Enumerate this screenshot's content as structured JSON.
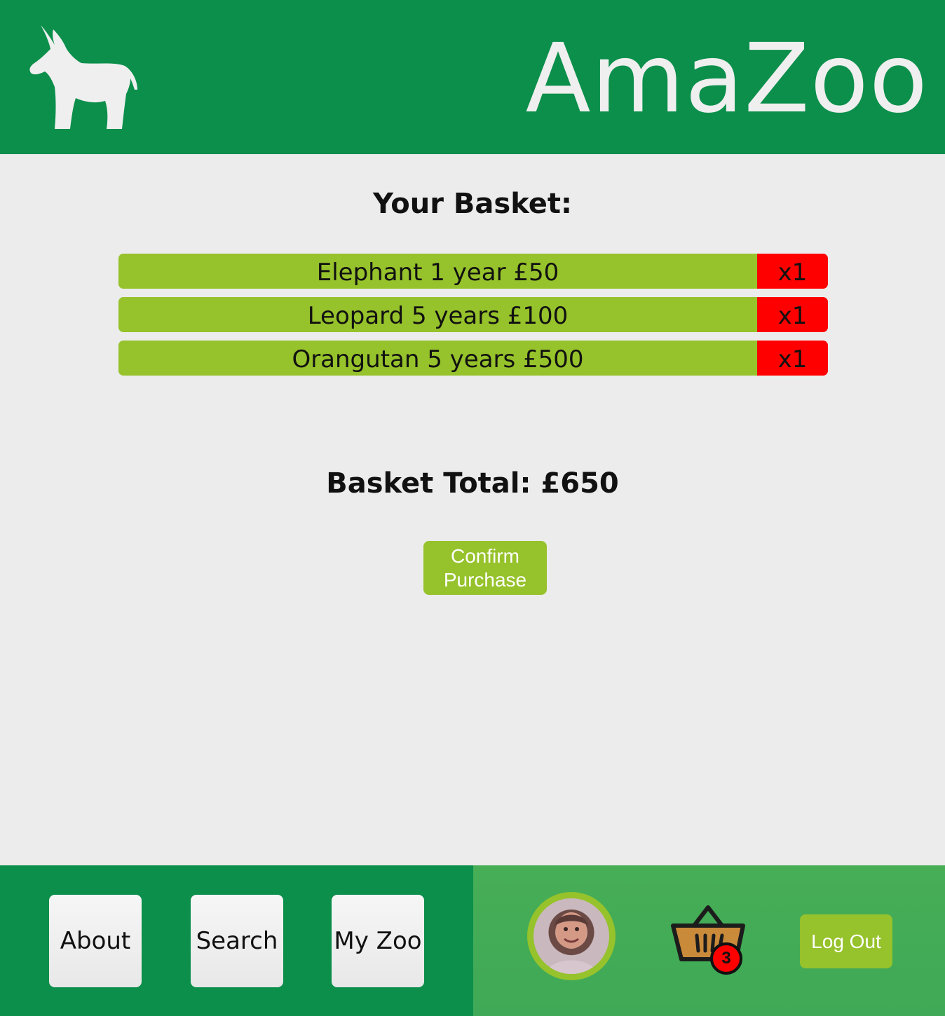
{
  "header": {
    "title": "AmaZoo",
    "logo_icon": "donkey-icon"
  },
  "basket": {
    "heading": "Your Basket:",
    "items": [
      {
        "label": "Elephant 1 year £50",
        "qty": "x1"
      },
      {
        "label": "Leopard 5 years £100",
        "qty": "x1"
      },
      {
        "label": "Orangutan 5 years £500",
        "qty": "x1"
      }
    ],
    "total": "Basket Total: £650",
    "confirm_label": "Confirm Purchase"
  },
  "footer": {
    "nav": [
      {
        "label": "About"
      },
      {
        "label": "Search"
      },
      {
        "label": "My Zoo"
      }
    ],
    "avatar_icon": "user-avatar",
    "basket_icon": "shopping-basket-icon",
    "basket_count": "3",
    "logout_label": "Log Out"
  },
  "colors": {
    "header_green": "#0b8f4b",
    "footer_right_green": "#47ae56",
    "accent_lime": "#96c22b",
    "qty_red": "#fe0000",
    "background": "#ececec"
  }
}
